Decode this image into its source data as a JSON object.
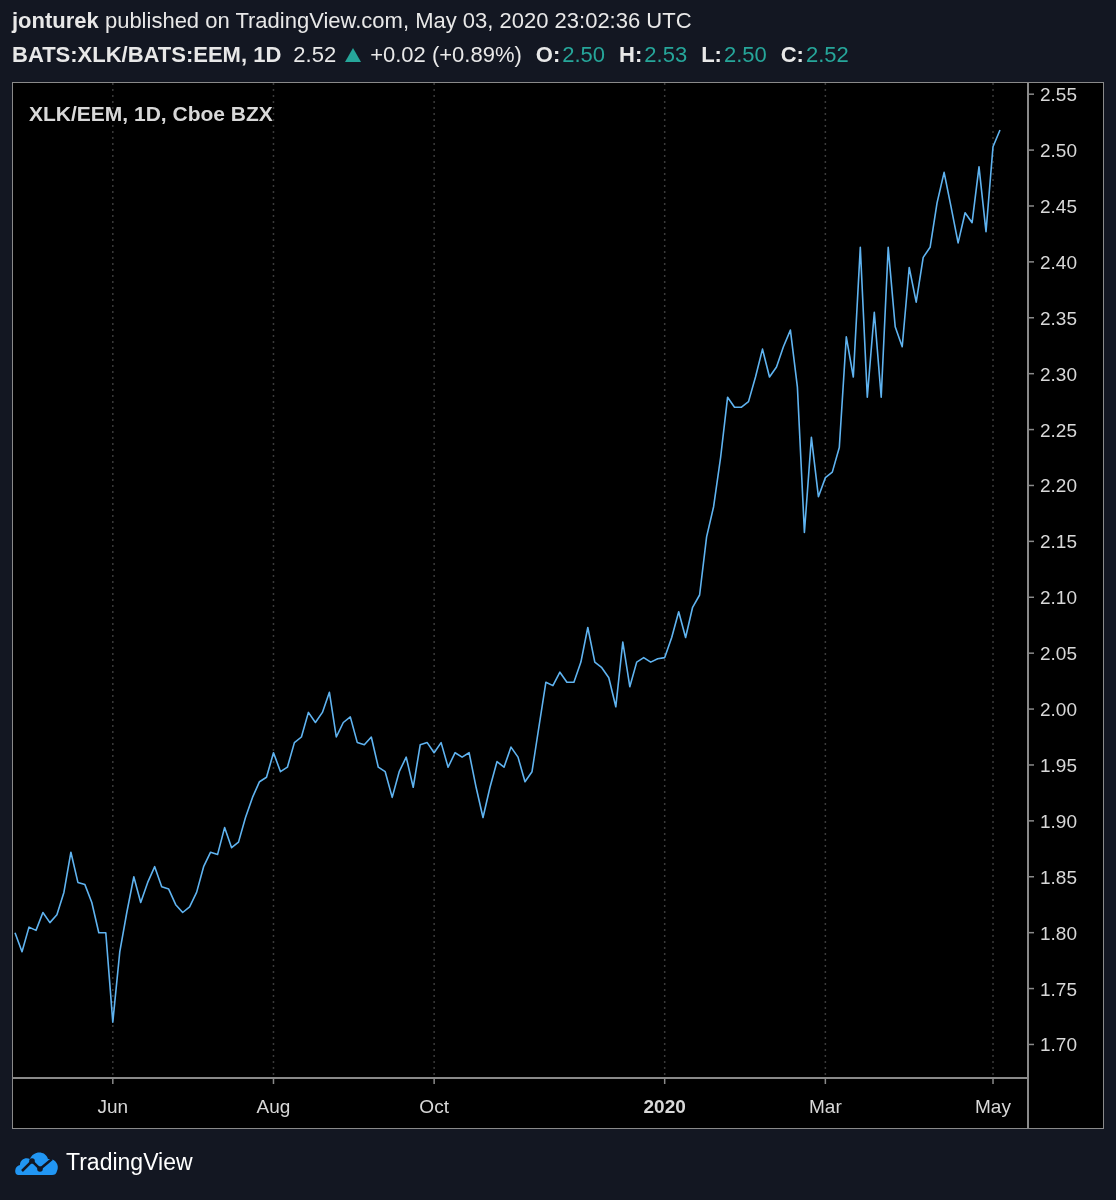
{
  "header": {
    "byline": "**jonturek** published on TradingView.com, May 03, 2020 23:02:36 UTC",
    "symbol": "BATS:XLK/BATS:EEM, 1D",
    "last": "2.52",
    "change": "+0.02 (+0.89%)",
    "ohlc": [
      {
        "label": "O:",
        "value": "2.50"
      },
      {
        "label": "H:",
        "value": "2.53"
      },
      {
        "label": "L:",
        "value": "2.50"
      },
      {
        "label": "C:",
        "value": "2.52"
      }
    ]
  },
  "chart": {
    "chart_data": {
      "type": "line",
      "title": "XLK/EEM, 1D, Cboe BZX",
      "ylim": [
        1.67,
        2.56
      ],
      "categories": [
        null,
        null,
        null,
        null,
        null,
        null,
        null,
        null,
        null,
        null,
        null,
        null,
        null,
        null,
        "Jun",
        null,
        null,
        null,
        null,
        null,
        null,
        null,
        null,
        null,
        null,
        null,
        null,
        null,
        null,
        null,
        null,
        null,
        null,
        null,
        null,
        null,
        null,
        "Aug",
        null,
        null,
        null,
        null,
        null,
        null,
        null,
        null,
        null,
        null,
        null,
        null,
        null,
        null,
        null,
        null,
        null,
        null,
        null,
        null,
        null,
        null,
        "Oct",
        null,
        null,
        null,
        null,
        null,
        null,
        null,
        null,
        null,
        null,
        null,
        null,
        null,
        null,
        null,
        null,
        null,
        null,
        null,
        null,
        null,
        null,
        null,
        null,
        null,
        null,
        null,
        null,
        null,
        null,
        null,
        null,
        "2020",
        null,
        null,
        null,
        null,
        null,
        null,
        null,
        null,
        null,
        null,
        null,
        null,
        null,
        null,
        null,
        null,
        null,
        null,
        null,
        null,
        null,
        null,
        "Mar",
        null,
        null,
        null,
        null,
        null,
        null,
        null,
        null,
        null,
        null,
        null,
        null,
        null,
        null,
        null,
        null,
        null,
        null,
        null,
        null,
        null,
        null,
        null,
        "May",
        null
      ],
      "series": [
        {
          "color": "#5fb3f0",
          "values": [
            1.8,
            1.783,
            1.805,
            1.802,
            1.818,
            1.809,
            1.816,
            1.836,
            1.872,
            1.845,
            1.843,
            1.827,
            1.8,
            1.8,
            1.72,
            1.783,
            1.818,
            1.85,
            1.827,
            1.845,
            1.859,
            1.841,
            1.839,
            1.825,
            1.818,
            1.823,
            1.836,
            1.859,
            1.872,
            1.87,
            1.894,
            1.876,
            1.881,
            1.903,
            1.921,
            1.935,
            1.939,
            1.961,
            1.944,
            1.948,
            1.97,
            1.975,
            1.997,
            1.988,
            1.997,
            2.015,
            1.975,
            1.988,
            1.993,
            1.97,
            1.968,
            1.975,
            1.948,
            1.944,
            1.921,
            1.944,
            1.957,
            1.93,
            1.968,
            1.97,
            1.961,
            1.97,
            1.948,
            1.961,
            1.957,
            1.961,
            1.93,
            1.903,
            1.93,
            1.953,
            1.948,
            1.966,
            1.957,
            1.935,
            1.944,
            1.984,
            2.024,
            2.021,
            2.033,
            2.024,
            2.024,
            2.042,
            2.073,
            2.042,
            2.037,
            2.028,
            2.002,
            2.06,
            2.02,
            2.042,
            2.046,
            2.042,
            2.045,
            2.046,
            2.064,
            2.087,
            2.064,
            2.091,
            2.102,
            2.154,
            2.181,
            2.225,
            2.279,
            2.27,
            2.27,
            2.275,
            2.297,
            2.322,
            2.297,
            2.306,
            2.324,
            2.339,
            2.288,
            2.158,
            2.243,
            2.19,
            2.207,
            2.212,
            2.234,
            2.333,
            2.297,
            2.413,
            2.279,
            2.355,
            2.279,
            2.413,
            2.342,
            2.324,
            2.395,
            2.364,
            2.404,
            2.413,
            2.453,
            2.48,
            2.449,
            2.417,
            2.444,
            2.435,
            2.485,
            2.427,
            2.503,
            2.518
          ]
        }
      ],
      "yticks": [
        {
          "value": 1.7,
          "label": "1.70"
        },
        {
          "value": 1.75,
          "label": "1.75"
        },
        {
          "value": 1.8,
          "label": "1.80"
        },
        {
          "value": 1.85,
          "label": "1.85"
        },
        {
          "value": 1.9,
          "label": "1.90"
        },
        {
          "value": 1.95,
          "label": "1.95"
        },
        {
          "value": 2.0,
          "label": "2.00"
        },
        {
          "value": 2.05,
          "label": "2.05"
        },
        {
          "value": 2.1,
          "label": "2.10"
        },
        {
          "value": 2.15,
          "label": "2.15"
        },
        {
          "value": 2.2,
          "label": "2.20"
        },
        {
          "value": 2.25,
          "label": "2.25"
        },
        {
          "value": 2.3,
          "label": "2.30"
        },
        {
          "value": 2.35,
          "label": "2.35"
        },
        {
          "value": 2.4,
          "label": "2.40"
        },
        {
          "value": 2.45,
          "label": "2.45"
        },
        {
          "value": 2.5,
          "label": "2.50"
        },
        {
          "value": 2.55,
          "label": "2.55"
        }
      ]
    }
  },
  "footer": {
    "brand": "TradingView"
  }
}
